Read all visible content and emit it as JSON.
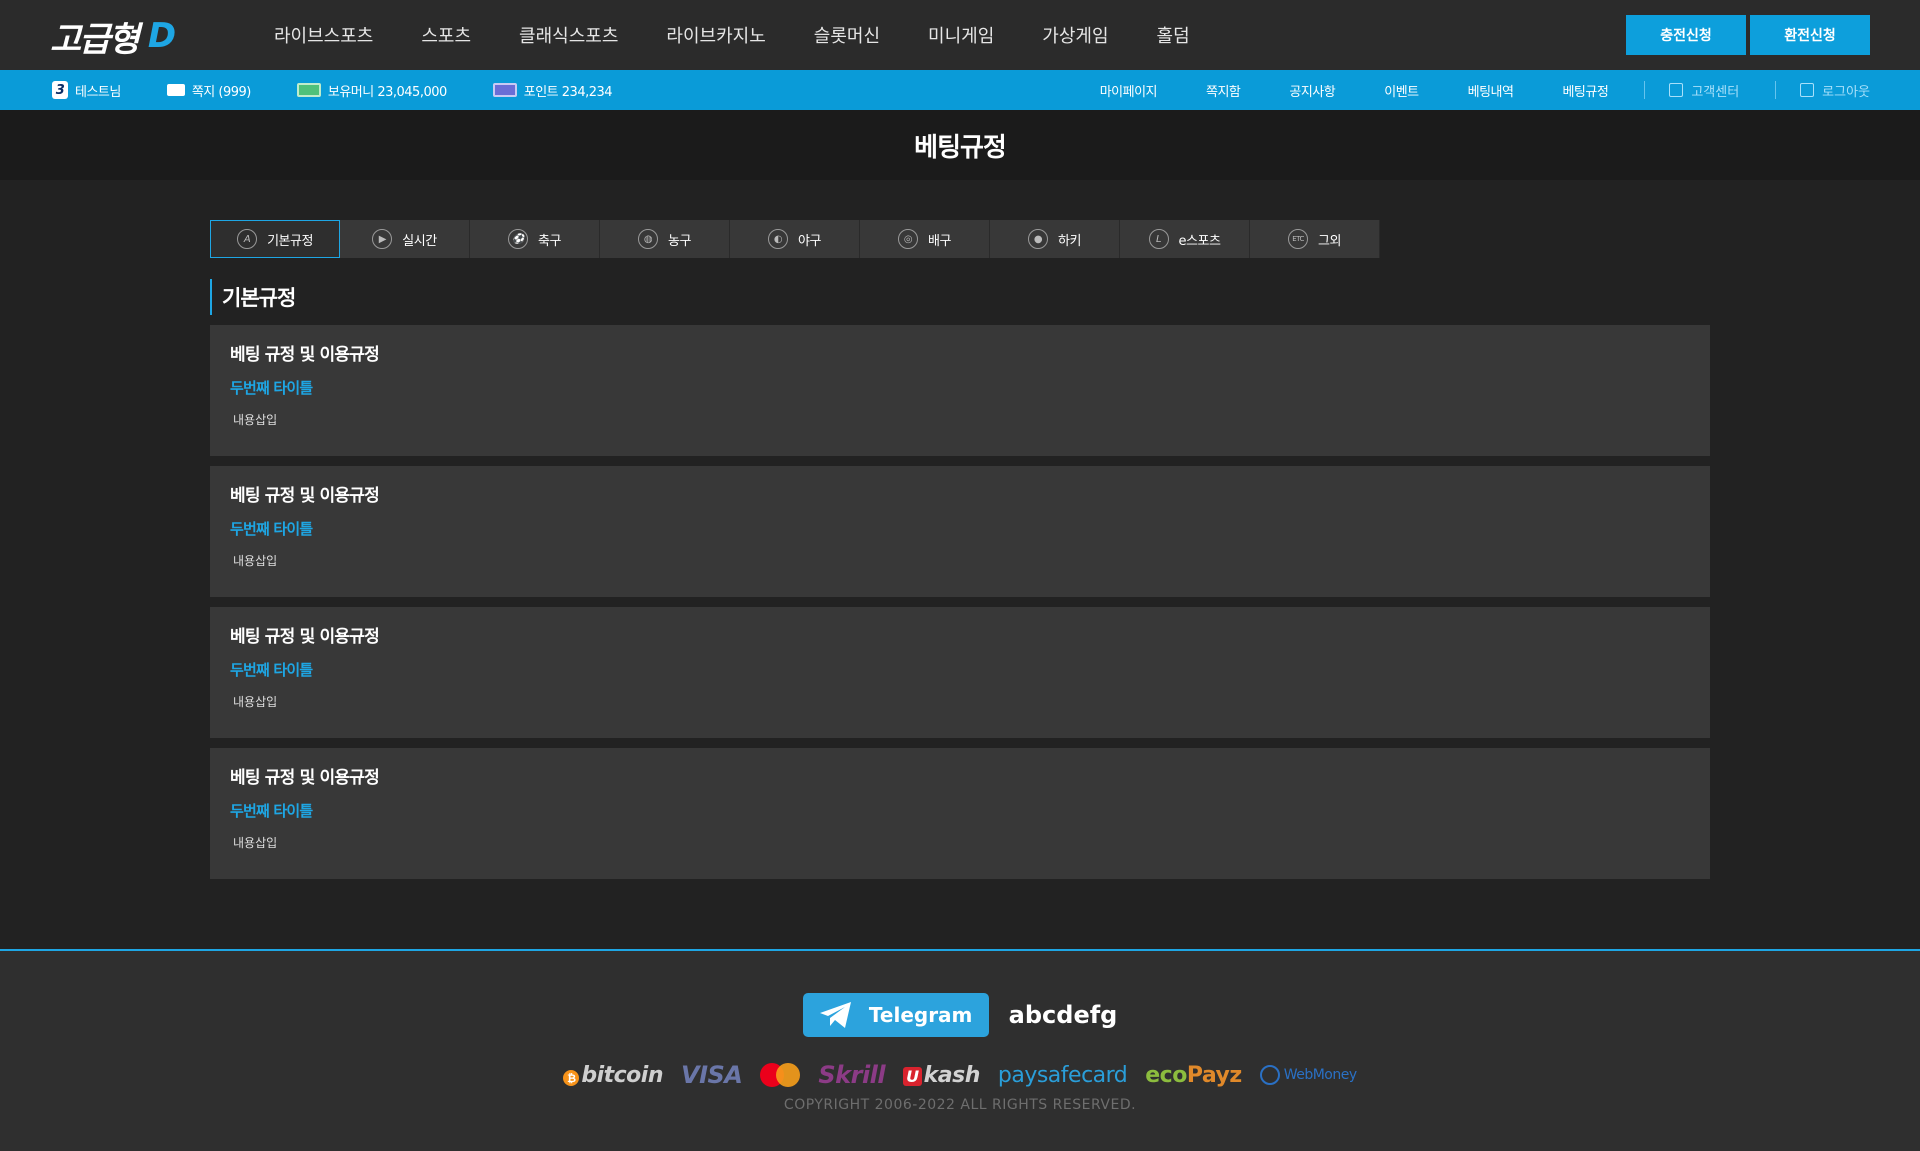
{
  "header": {
    "logo_text": "고급형",
    "logo_accent": "D",
    "nav": [
      "라이브스포츠",
      "스포츠",
      "클래식스포츠",
      "라이브카지노",
      "슬롯머신",
      "미니게임",
      "가상게임",
      "홀덤"
    ],
    "buttons": {
      "deposit": "충전신청",
      "withdraw": "환전신청"
    }
  },
  "userbar": {
    "level": "3",
    "username": "테스트님",
    "messages": "쪽지 (999)",
    "money": "보유머니 23,045,000",
    "points": "포인트 234,234",
    "menu": [
      "마이페이지",
      "쪽지함",
      "공지사항",
      "이벤트",
      "베팅내역",
      "베팅규정"
    ],
    "support": "고객센터",
    "logout": "로그아웃"
  },
  "page": {
    "title": "베팅규정"
  },
  "tabs": [
    {
      "label": "기본규정",
      "icon": "A"
    },
    {
      "label": "실시간",
      "icon": "▶"
    },
    {
      "label": "축구",
      "icon": "⚽"
    },
    {
      "label": "농구",
      "icon": "◍"
    },
    {
      "label": "야구",
      "icon": "◐"
    },
    {
      "label": "배구",
      "icon": "◎"
    },
    {
      "label": "하키",
      "icon": "●"
    },
    {
      "label": "e스포츠",
      "icon": "L"
    },
    {
      "label": "그외",
      "icon": "ETC"
    }
  ],
  "section": {
    "title": "기본규정"
  },
  "rules": [
    {
      "title": "베팅 규정 및 이용규정",
      "subtitle": "두번째 타이틀",
      "body": "내용삽입"
    },
    {
      "title": "베팅 규정 및 이용규정",
      "subtitle": "두번째 타이틀",
      "body": "내용삽입"
    },
    {
      "title": "베팅 규정 및 이용규정",
      "subtitle": "두번째 타이틀",
      "body": "내용삽입"
    },
    {
      "title": "베팅 규정 및 이용규정",
      "subtitle": "두번째 타이틀",
      "body": "내용삽입"
    }
  ],
  "footer": {
    "telegram_label": "Telegram",
    "telegram_id": "abcdefg",
    "payments": {
      "bitcoin": "bitcoin",
      "visa": "VISA",
      "skrill": "Skrill",
      "ukash_u": "U",
      "ukash": "kash",
      "paysafe": "paysafecard",
      "eco": "eco",
      "payz": "Payz",
      "webmoney": "WebMoney"
    },
    "copyright": "COPYRIGHT  2006-2022  ALL RIGHTS RESERVED."
  },
  "colors": {
    "accent": "#0a9bd8",
    "highlight": "#1ea6e4",
    "card_bg": "#383838",
    "page_bg": "#222222"
  }
}
